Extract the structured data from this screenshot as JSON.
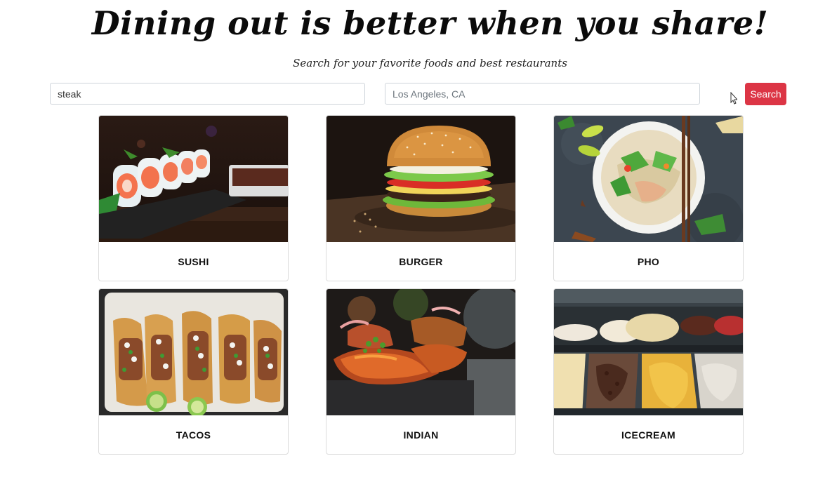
{
  "hero": {
    "title": "Dining out is better when you share!",
    "subtitle": "Search for your favorite foods and best restaurants"
  },
  "search": {
    "food_value": "steak",
    "location_placeholder": "Los Angeles, CA",
    "button_label": "Search",
    "button_color": "#dc3545"
  },
  "categories": [
    {
      "label": "SUSHI",
      "image": "sushi-rolls-photo"
    },
    {
      "label": "BURGER",
      "image": "burger-photo"
    },
    {
      "label": "PHO",
      "image": "pho-bowl-photo"
    },
    {
      "label": "TACOS",
      "image": "tacos-photo"
    },
    {
      "label": "INDIAN",
      "image": "indian-skewers-photo"
    },
    {
      "label": "ICECREAM",
      "image": "ice-cream-display-photo"
    }
  ]
}
